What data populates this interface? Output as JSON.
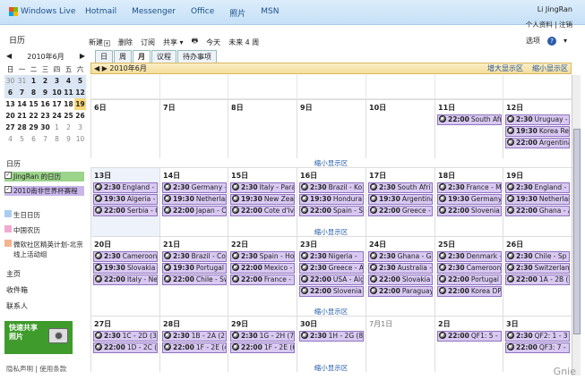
{
  "topbar": {
    "brand": "Windows Live",
    "nav": [
      "Hotmail",
      "Messenger",
      "Office",
      "照片",
      "MSN"
    ],
    "user": "Li JingRan",
    "user_links": "个人资料 | 注销"
  },
  "left": {
    "title": "日历",
    "mini_title": "2010年6月",
    "weekdays": [
      "日",
      "一",
      "二",
      "三",
      "四",
      "五",
      "六"
    ],
    "weeks": [
      [
        {
          "d": "30",
          "c": "dim"
        },
        {
          "d": "31",
          "c": "dim"
        },
        {
          "d": "1",
          "c": "b"
        },
        {
          "d": "2",
          "c": "b"
        },
        {
          "d": "3",
          "c": "b"
        },
        {
          "d": "4",
          "c": "b"
        },
        {
          "d": "5",
          "c": "b"
        }
      ],
      [
        {
          "d": "6",
          "c": "b"
        },
        {
          "d": "7",
          "c": "b"
        },
        {
          "d": "8",
          "c": "b"
        },
        {
          "d": "9",
          "c": "b"
        },
        {
          "d": "10",
          "c": "b"
        },
        {
          "d": "11",
          "c": "b"
        },
        {
          "d": "12",
          "c": "b"
        }
      ],
      [
        {
          "d": "13",
          "c": "b"
        },
        {
          "d": "14",
          "c": "b"
        },
        {
          "d": "15",
          "c": "b"
        },
        {
          "d": "16",
          "c": "b"
        },
        {
          "d": "17",
          "c": "b"
        },
        {
          "d": "18",
          "c": "b"
        },
        {
          "d": "19",
          "c": "today"
        }
      ],
      [
        {
          "d": "20",
          "c": "b"
        },
        {
          "d": "21",
          "c": "b"
        },
        {
          "d": "22",
          "c": "b"
        },
        {
          "d": "23",
          "c": "b"
        },
        {
          "d": "24",
          "c": "b"
        },
        {
          "d": "25",
          "c": "b"
        },
        {
          "d": "26",
          "c": "b"
        }
      ],
      [
        {
          "d": "27",
          "c": "b"
        },
        {
          "d": "28",
          "c": "b"
        },
        {
          "d": "29",
          "c": "b"
        },
        {
          "d": "30",
          "c": "b"
        },
        {
          "d": "1",
          "c": "dim"
        },
        {
          "d": "2",
          "c": "dim"
        },
        {
          "d": "3",
          "c": "dim"
        }
      ],
      [
        {
          "d": "4",
          "c": "dim"
        },
        {
          "d": "5",
          "c": "dim"
        },
        {
          "d": "6",
          "c": "dim"
        },
        {
          "d": "7",
          "c": "dim"
        },
        {
          "d": "8",
          "c": "dim"
        },
        {
          "d": "9",
          "c": "dim"
        },
        {
          "d": "10",
          "c": "dim"
        }
      ]
    ],
    "cal_section": "日历",
    "calendars": [
      {
        "label": "JingRan 的日历",
        "color": "#9bd48a",
        "checked": true
      },
      {
        "label": "2010南非世界杯赛程",
        "color": "#c9b6ec",
        "checked": true
      },
      {
        "label": "生日日历",
        "color": "#a9cdf0",
        "checked": false
      },
      {
        "label": "中国农历",
        "color": "#f2a9cf",
        "checked": false
      },
      {
        "label": "微软社区精英计划-北京线上活动组",
        "color": "#f4b391",
        "checked": false
      }
    ],
    "links": [
      "主页",
      "收件箱",
      "联系人"
    ],
    "promo": "快速共享照片",
    "footer": "隐私声明 | 使用条款"
  },
  "toolbar": {
    "items": [
      "新建",
      "删除",
      "订阅",
      "共享",
      "今天",
      "未来 4 周"
    ],
    "options": "选项"
  },
  "tabs": [
    "日",
    "周",
    "月",
    "议程",
    "待办事项"
  ],
  "monthbar": {
    "title": "2010年6月",
    "zoom_in": "增大显示区",
    "zoom_out": "缩小显示区"
  },
  "shrink_label": "缩小显示区",
  "header_days": [
    {
      "d": "6日"
    },
    {
      "d": "7日"
    },
    {
      "d": "8日"
    },
    {
      "d": "9日"
    },
    {
      "d": "10日"
    },
    {
      "d": "11日",
      "ev": [
        [
          "22:00",
          "South Afr"
        ]
      ]
    },
    {
      "d": "12日",
      "ev": [
        [
          "2:30",
          "Uruguay - "
        ],
        [
          "19:30",
          "Korea Re"
        ],
        [
          "22:00",
          "Argentina"
        ]
      ]
    }
  ],
  "weeks": [
    [
      {
        "d": "13日",
        "ev": [
          [
            "2:30",
            "England - "
          ],
          [
            "19:30",
            "Algeria - "
          ],
          [
            "22:00",
            "Serbia - G"
          ]
        ]
      },
      {
        "d": "14日",
        "ev": [
          [
            "2:30",
            "Germany -"
          ],
          [
            "19:30",
            "Netherlan"
          ],
          [
            "22:00",
            "Japan - C"
          ]
        ]
      },
      {
        "d": "15日",
        "ev": [
          [
            "2:30",
            "Italy - Para"
          ],
          [
            "19:30",
            "New Zeal"
          ],
          [
            "22:00",
            "Cote d'Iv"
          ]
        ]
      },
      {
        "d": "16日",
        "ev": [
          [
            "2:30",
            "Brazil - Ko"
          ],
          [
            "19:30",
            "Hondura"
          ],
          [
            "22:00",
            "Spain - S"
          ]
        ]
      },
      {
        "d": "17日",
        "ev": [
          [
            "2:30",
            "South Afri"
          ],
          [
            "19:30",
            "Argentina"
          ],
          [
            "22:00",
            "Greece - "
          ]
        ]
      },
      {
        "d": "18日",
        "ev": [
          [
            "2:30",
            "France - M"
          ],
          [
            "19:30",
            "Germany"
          ],
          [
            "22:00",
            "Slovenia"
          ]
        ]
      },
      {
        "d": "19日",
        "ev": [
          [
            "2:30",
            "England -"
          ],
          [
            "19:30",
            "Netherlan"
          ],
          [
            "22:00",
            "Ghana - A"
          ]
        ]
      }
    ],
    [
      {
        "d": "20日",
        "ev": [
          [
            "2:30",
            "Cameroon"
          ],
          [
            "19:30",
            "Slovakia"
          ],
          [
            "22:00",
            "Italy - Ne"
          ]
        ]
      },
      {
        "d": "21日",
        "ev": [
          [
            "2:30",
            "Brazil - Co"
          ],
          [
            "19:30",
            "Portugal "
          ],
          [
            "22:00",
            "Chile - Sw"
          ]
        ]
      },
      {
        "d": "22日",
        "ev": [
          [
            "2:30",
            "Spain - Ho"
          ],
          [
            "22:00",
            "Mexico - "
          ],
          [
            "22:00",
            "France - "
          ]
        ]
      },
      {
        "d": "23日",
        "ev": [
          [
            "2:30",
            "Nigeria - "
          ],
          [
            "2:30",
            "Greece - A"
          ],
          [
            "22:00",
            "USA - Alg"
          ],
          [
            "22:00",
            "Slovenia "
          ]
        ]
      },
      {
        "d": "24日",
        "ev": [
          [
            "2:30",
            "Ghana - G"
          ],
          [
            "2:30",
            "Australia -"
          ],
          [
            "22:00",
            "Slovakia -"
          ],
          [
            "22:00",
            "Paraguay "
          ]
        ]
      },
      {
        "d": "25日",
        "ev": [
          [
            "2:30",
            "Denmark -"
          ],
          [
            "2:30",
            "Cameroon"
          ],
          [
            "22:00",
            "Portugal"
          ],
          [
            "22:00",
            "Korea DP"
          ]
        ]
      },
      {
        "d": "26日",
        "ev": [
          [
            "2:30",
            "Chile - Sp"
          ],
          [
            "2:30",
            "Switzerlan"
          ],
          [
            "22:00",
            "1A - 2B ("
          ]
        ]
      }
    ],
    [
      {
        "d": "27日",
        "ev": [
          [
            "2:30",
            "1C - 2D (3"
          ],
          [
            "22:00",
            "1D - 2C ("
          ]
        ]
      },
      {
        "d": "28日",
        "ev": [
          [
            "2:30",
            "1B - 2A (2"
          ],
          [
            "22:00",
            "1F - 2E (4"
          ]
        ]
      },
      {
        "d": "29日",
        "ev": [
          [
            "2:30",
            "1G - 2H (7"
          ],
          [
            "22:00",
            "1F - 2E (6"
          ]
        ]
      },
      {
        "d": "30日",
        "ev": [
          [
            "2:30",
            "1H - 2G (8"
          ]
        ]
      },
      {
        "d": "7月1日",
        "dim": true
      },
      {
        "d": "2日",
        "ev": [
          [
            "22:00",
            "QF1: 5 -"
          ]
        ]
      },
      {
        "d": "3日",
        "ev": [
          [
            "2:30",
            "QF2: 1 - 3"
          ],
          [
            "22:00",
            "QF3: 7 -"
          ]
        ]
      }
    ]
  ],
  "watermark": "Gnie",
  "colors": {
    "event_bg": "#d9c9f2",
    "event_border": "#8f73bf",
    "accent": "#2259a8",
    "today": "#f8d77a"
  }
}
